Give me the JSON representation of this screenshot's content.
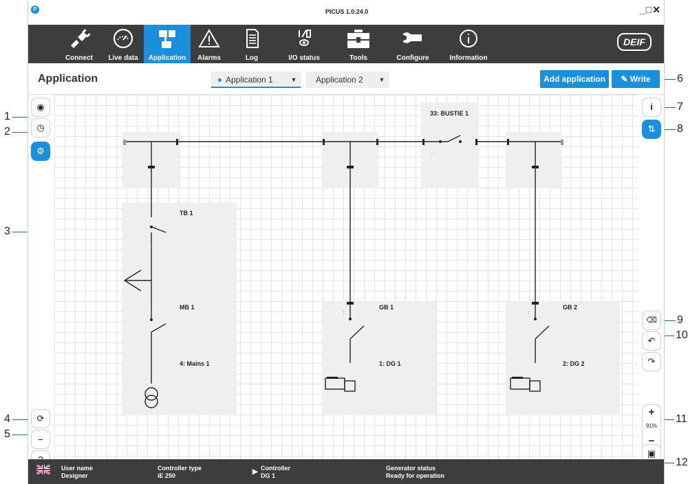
{
  "window": {
    "title": "PICUS 1.0.24.0",
    "controls": "_□✕"
  },
  "nav": {
    "items": [
      {
        "label": "Connect",
        "icon": "plug-icon"
      },
      {
        "label": "Live data",
        "icon": "gauge-icon"
      },
      {
        "label": "Application",
        "icon": "application-icon",
        "active": true
      },
      {
        "label": "Alarms",
        "icon": "warning-icon"
      },
      {
        "label": "Log",
        "icon": "log-icon"
      },
      {
        "label": "I/O status",
        "icon": "io-status-icon"
      },
      {
        "label": "Tools",
        "icon": "toolbox-icon"
      },
      {
        "label": "Configure",
        "icon": "wrench-icon"
      },
      {
        "label": "Information",
        "icon": "info-icon"
      }
    ],
    "brand": "DEIF"
  },
  "appbar": {
    "title": "Application",
    "tabs": [
      {
        "label": "Application 1",
        "active": true
      },
      {
        "label": "Application 2",
        "active": false
      }
    ],
    "add_label": "Add application",
    "write_label": "Write"
  },
  "callouts": [
    "1",
    "2",
    "3",
    "4",
    "5",
    "6",
    "7",
    "8",
    "9",
    "10",
    "11",
    "12"
  ],
  "diagram": {
    "bustie_label": "33: BUSTIE 1",
    "tb_label": "TB 1",
    "mb_label": "MB 1",
    "mains_label": "4: Mains 1",
    "gb1_label": "GB 1",
    "dg1_label": "1: DG 1",
    "gb2_label": "GB 2",
    "dg2_label": "2: DG 2"
  },
  "zoom": {
    "level": "91%",
    "plus": "+",
    "minus": "−"
  },
  "status": {
    "user_title": "User name",
    "user_value": "Designer",
    "ctype_title": "Controller type",
    "ctype_value": "iE 250",
    "ctrl_title": "Controller",
    "ctrl_value": "DG 1",
    "gen_title": "Generator status",
    "gen_value": "Ready for operation"
  },
  "colors": {
    "accent": "#1a8fdc",
    "nav_bg": "#3d3d3d",
    "callout_line": "#2a6b5a"
  }
}
